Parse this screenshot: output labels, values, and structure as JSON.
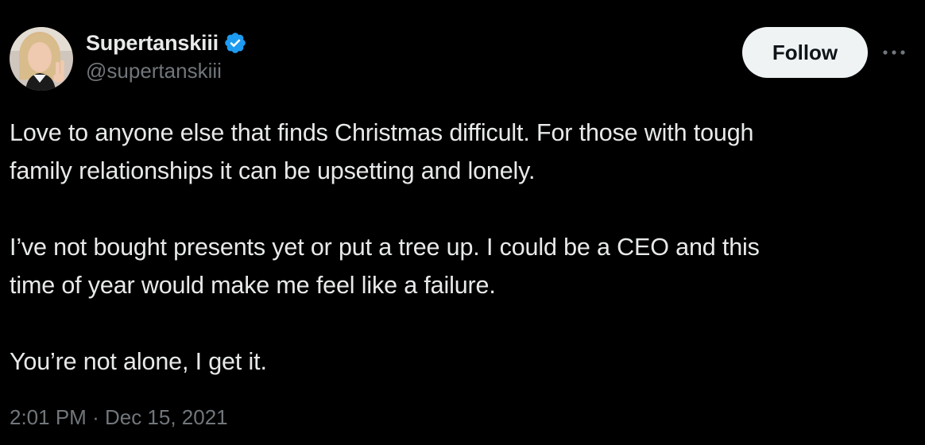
{
  "tweet": {
    "author": {
      "display_name": "Supertanskiii",
      "handle": "@supertanskiii",
      "verified": true,
      "verified_color": "#1d9bf0"
    },
    "follow_label": "Follow",
    "more_icon": "more-horizontal-icon",
    "paragraphs": [
      {
        "line1": "Love to anyone else that finds Christmas difficult. For those with tough",
        "line2": "family relationships it can be upsetting and lonely."
      },
      {
        "line1": "I’ve not bought presents yet or put a tree up. I could be a CEO and this",
        "line2": "time of year would make me feel like a failure."
      },
      {
        "line1": "You’re not alone, I get it."
      }
    ],
    "time": "2:01 PM",
    "separator": "·",
    "date": "Dec 15, 2021"
  },
  "colors": {
    "background": "#000000",
    "primary_text": "#e7e9ea",
    "secondary_text": "#71767b",
    "follow_button_bg": "#eff3f4",
    "follow_button_text": "#0f1419"
  }
}
